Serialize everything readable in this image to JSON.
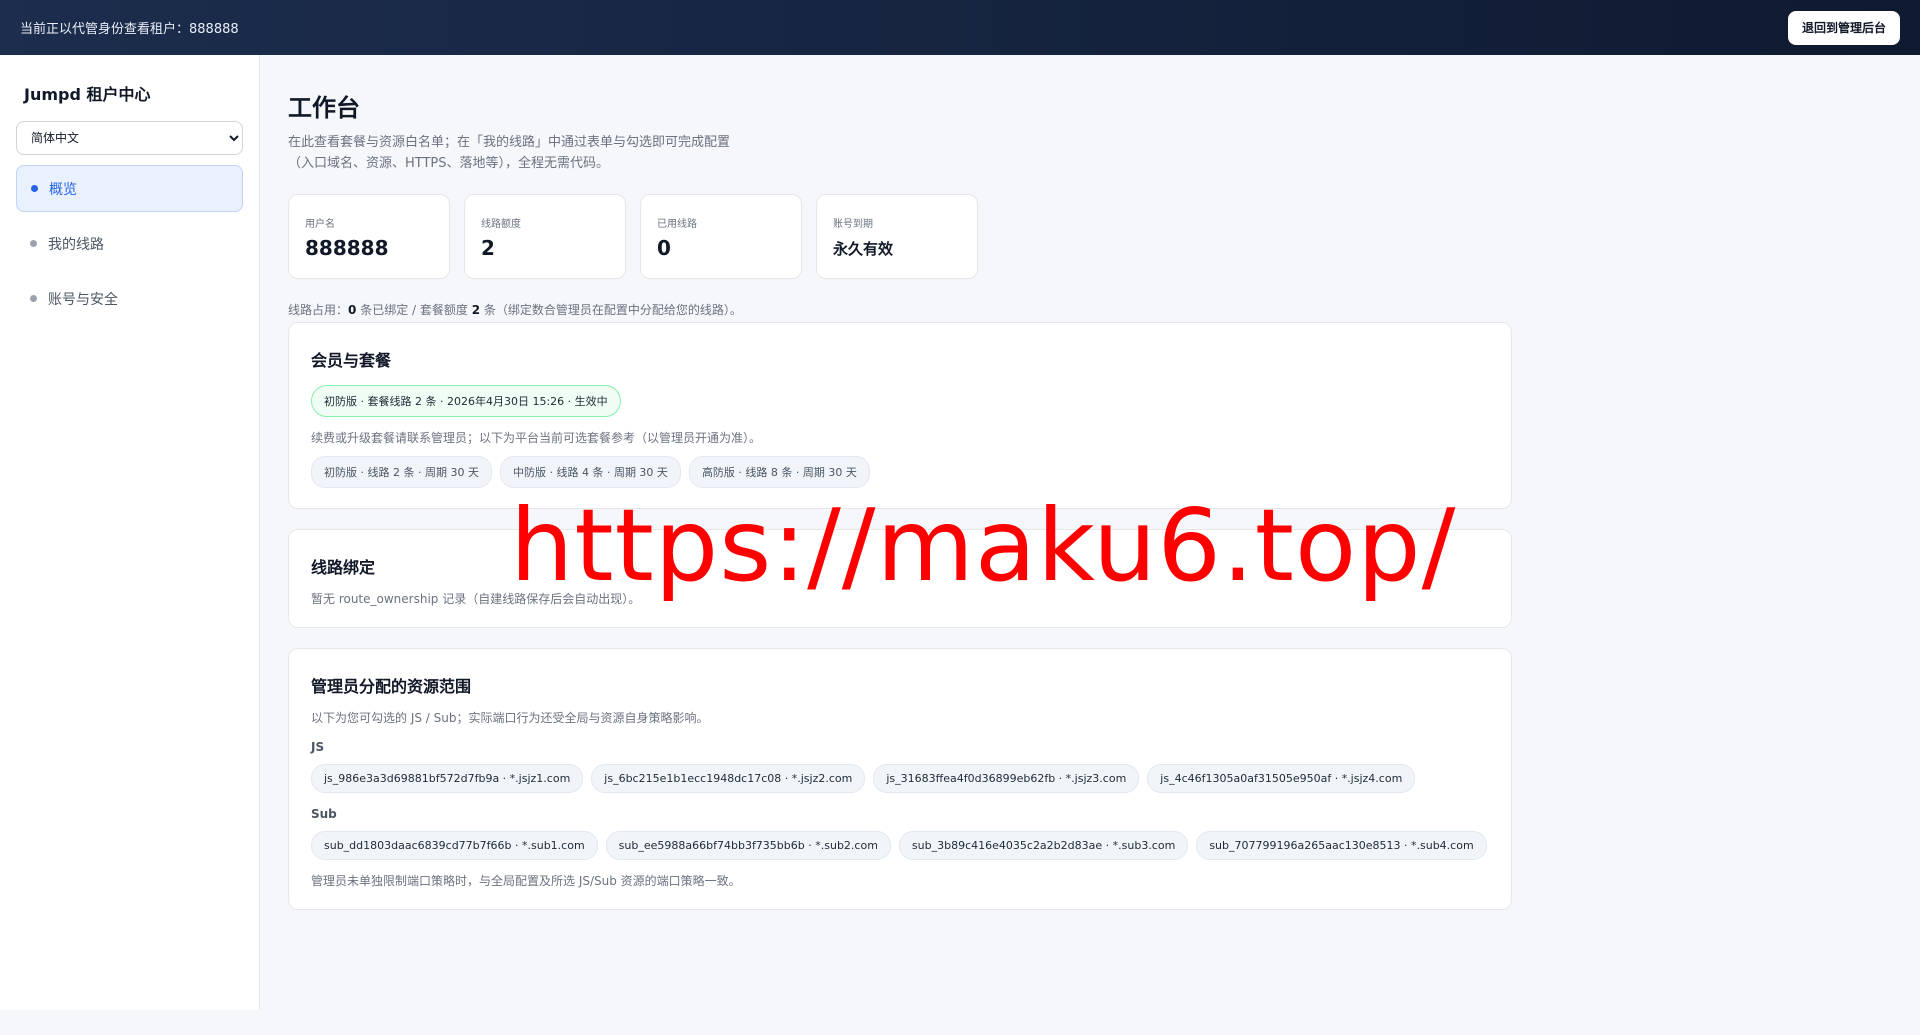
{
  "topbar": {
    "impersonation_text": "当前正以代管身份查看租户：888888",
    "back_button_label": "退回到管理后台"
  },
  "sidebar": {
    "brand": "Jumpd 租户中心",
    "language": {
      "selected": "简体中文"
    },
    "items": [
      {
        "label": "概览",
        "active": true
      },
      {
        "label": "我的线路",
        "active": false
      },
      {
        "label": "账号与安全",
        "active": false
      }
    ]
  },
  "main": {
    "title": "工作台",
    "description": "在此查看套餐与资源白名单；在「我的线路」中通过表单与勾选即可完成配置（入口域名、资源、HTTPS、落地等），全程无需代码。",
    "stats": [
      {
        "label": "用户名",
        "value": "888888"
      },
      {
        "label": "线路额度",
        "value": "2"
      },
      {
        "label": "已用线路",
        "value": "0"
      },
      {
        "label": "账号到期",
        "value": "永久有效"
      }
    ],
    "usage": {
      "prefix": "线路占用：",
      "bound": "0",
      "middle": " 条已绑定 / 套餐额度 ",
      "quota": "2",
      "suffix": " 条（绑定数合管理员在配置中分配给您的线路）。"
    },
    "membership": {
      "title": "会员与套餐",
      "current_plan": "初防版 · 套餐线路 2 条 · 2026年4月30日 15:26 · 生效中",
      "note": "续费或升级套餐请联系管理员；以下为平台当前可选套餐参考（以管理员开通为准）。",
      "plans": [
        "初防版 · 线路 2 条 · 周期 30 天",
        "中防版 · 线路 4 条 · 周期 30 天",
        "高防版 · 线路 8 条 · 周期 30 天"
      ]
    },
    "binding": {
      "title": "线路绑定",
      "empty_text": "暂无 route_ownership 记录（自建线路保存后会自动出现）。"
    },
    "resources": {
      "title": "管理员分配的资源范围",
      "note": "以下为您可勾选的 JS / Sub；实际端口行为还受全局与资源自身策略影响。",
      "js_label": "JS",
      "js": [
        "js_986e3a3d69881bf572d7fb9a · *.jsjz1.com",
        "js_6bc215e1b1ecc1948dc17c08 · *.jsjz2.com",
        "js_31683ffea4f0d36899eb62fb · *.jsjz3.com",
        "js_4c46f1305a0af31505e950af · *.jsjz4.com"
      ],
      "sub_label": "Sub",
      "sub": [
        "sub_dd1803daac6839cd77b7f66b · *.sub1.com",
        "sub_ee5988a66bf74bb3f735bb6b · *.sub2.com",
        "sub_3b89c416e4035c2a2b2d83ae · *.sub3.com",
        "sub_707799196a265aac130e8513 · *.sub4.com"
      ],
      "footer": "管理员未单独限制端口策略时，与全局配置及所选 JS/Sub 资源的端口策略一致。"
    }
  },
  "watermark": "https://maku6.top/"
}
